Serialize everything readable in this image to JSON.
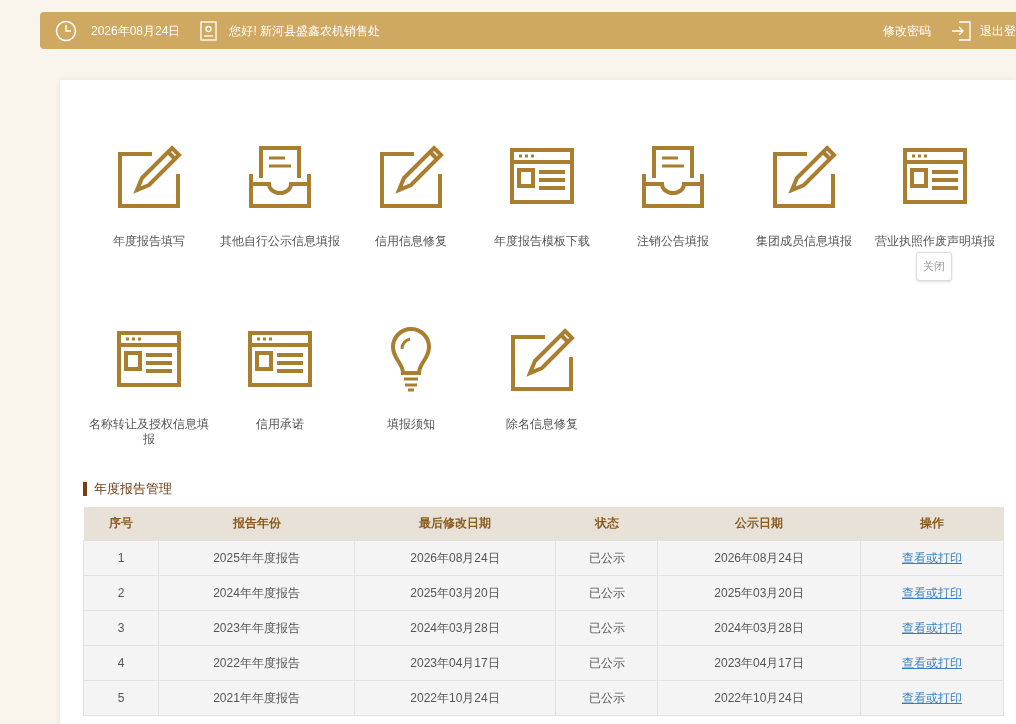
{
  "header": {
    "date": "2026年08月24日",
    "greeting": "您好! 新河县盛鑫农机销售处",
    "links": [
      "修改密码",
      "退出登"
    ]
  },
  "functions": [
    {
      "label": "年度报告填写",
      "kind": "edit"
    },
    {
      "label": "其他自行公示信息填报",
      "kind": "inbox"
    },
    {
      "label": "信用信息修复",
      "kind": "edit"
    },
    {
      "label": "年度报告模板下载",
      "kind": "window"
    },
    {
      "label": "注销公告填报",
      "kind": "inbox"
    },
    {
      "label": "集团成员信息填报",
      "kind": "edit"
    },
    {
      "label": "营业执照作废声明填报",
      "kind": "window"
    },
    {
      "label": "名称转让及授权信息填报",
      "kind": "window"
    },
    {
      "label": "信用承诺",
      "kind": "window"
    },
    {
      "label": "填报须知",
      "kind": "bulb"
    },
    {
      "label": "除名信息修复",
      "kind": "edit"
    }
  ],
  "tooltip": "关闭",
  "section_title": "年度报告管理",
  "table": {
    "columns": [
      "序号",
      "报告年份",
      "最后修改日期",
      "状态",
      "公示日期",
      "操作"
    ],
    "rows": [
      [
        "1",
        "2025年年度报告",
        "2026年08月24日",
        "已公示",
        "2026年08月24日",
        "查看或打印"
      ],
      [
        "2",
        "2024年年度报告",
        "2025年03月20日",
        "已公示",
        "2025年03月20日",
        "查看或打印"
      ],
      [
        "3",
        "2023年年度报告",
        "2024年03月28日",
        "已公示",
        "2024年03月28日",
        "查看或打印"
      ],
      [
        "4",
        "2022年年度报告",
        "2023年04月17日",
        "已公示",
        "2023年04月17日",
        "查看或打印"
      ],
      [
        "5",
        "2021年年度报告",
        "2022年10月24日",
        "已公示",
        "2022年10月24日",
        "查看或打印"
      ]
    ]
  }
}
